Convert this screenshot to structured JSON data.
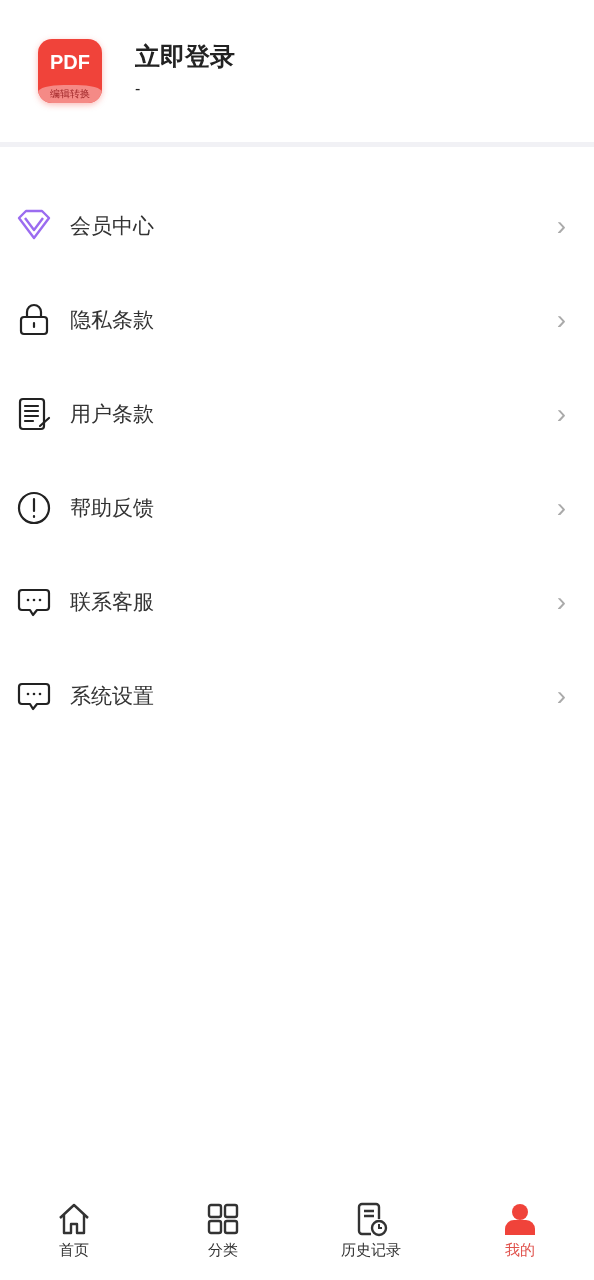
{
  "profile": {
    "logo": {
      "title": "PDF",
      "subtitle": "编辑转换"
    },
    "name": "立即登录",
    "detail": "-"
  },
  "menu": [
    {
      "kind": "diamond",
      "label": "会员中心",
      "chevron": "›"
    },
    {
      "kind": "lock",
      "label": "隐私条款",
      "chevron": "›"
    },
    {
      "kind": "document",
      "label": "用户条款",
      "chevron": "›"
    },
    {
      "kind": "alert",
      "label": "帮助反馈",
      "chevron": "›"
    },
    {
      "kind": "chat",
      "label": "联系客服",
      "chevron": "›"
    },
    {
      "kind": "chat",
      "label": "系统设置",
      "chevron": "›"
    }
  ],
  "tab_bar": [
    {
      "kind": "home",
      "label": "首页",
      "selected": false
    },
    {
      "kind": "grid",
      "label": "分类",
      "selected": false
    },
    {
      "kind": "history",
      "label": "历史记录",
      "selected": false
    },
    {
      "kind": "person",
      "label": "我的",
      "selected": true
    }
  ]
}
